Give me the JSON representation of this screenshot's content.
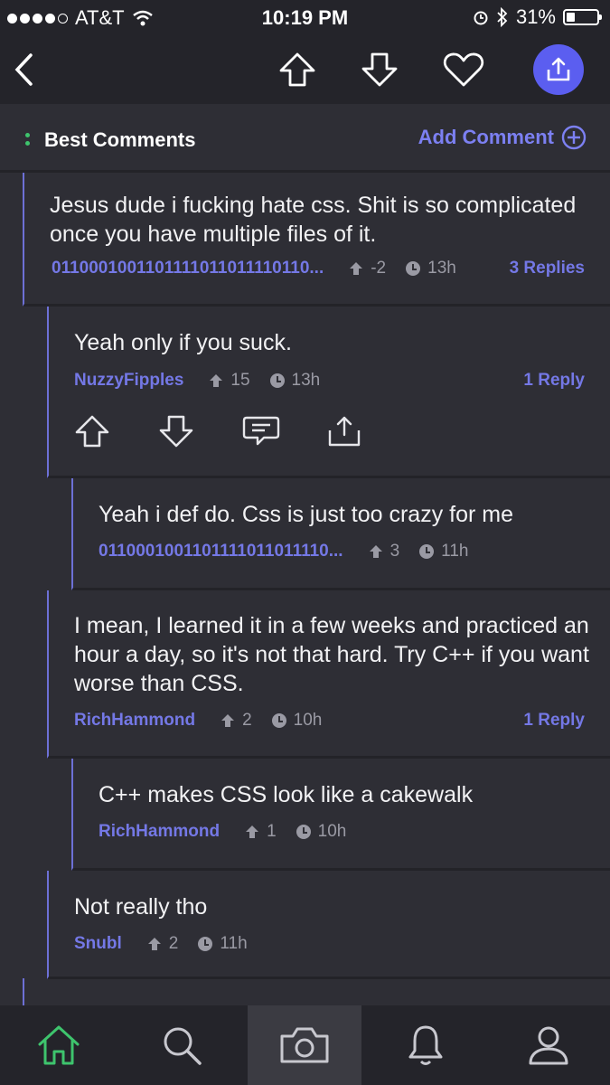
{
  "status_bar": {
    "carrier": "AT&T",
    "time": "10:19 PM",
    "battery": "31%"
  },
  "nav": {
    "back_icon": "chevron-left-icon",
    "upvote_icon": "arrow-up-icon",
    "downvote_icon": "arrow-down-icon",
    "favorite_icon": "heart-icon",
    "share_icon": "share-icon",
    "accent": "#5b5ef0"
  },
  "header": {
    "title": "Best Comments",
    "add_label": "Add Comment"
  },
  "comments": [
    {
      "text": "Jesus dude i fucking hate css. Shit is so complicated once you have multiple files of it.",
      "user": "0110001001101111011011110110...",
      "score": "-2",
      "age": "13h",
      "replies": "3 Replies"
    },
    {
      "text": "Yeah only if you suck.",
      "user": "NuzzyFipples",
      "score": "15",
      "age": "13h",
      "replies": "1 Reply"
    },
    {
      "text": "Yeah i def do. Css is just too crazy for me",
      "user": "0110001001101111011011110...",
      "score": "3",
      "age": "11h"
    },
    {
      "text": "I mean, I learned it in a few weeks and practiced an hour a day, so it's not that hard. Try C++ if you want worse than CSS.",
      "user": "RichHammond",
      "score": "2",
      "age": "10h",
      "replies": "1 Reply"
    },
    {
      "text": "C++ makes CSS look like a cakewalk",
      "user": "RichHammond",
      "score": "1",
      "age": "10h"
    },
    {
      "text": "Not really tho",
      "user": "Snubl",
      "score": "2",
      "age": "11h"
    }
  ],
  "tabs": [
    "home-icon",
    "search-icon",
    "camera-icon",
    "bell-icon",
    "profile-icon"
  ],
  "colors": {
    "link": "#7478e6",
    "background": "#2e2e35",
    "bar": "#24242a",
    "home_active": "#3ec46d"
  }
}
